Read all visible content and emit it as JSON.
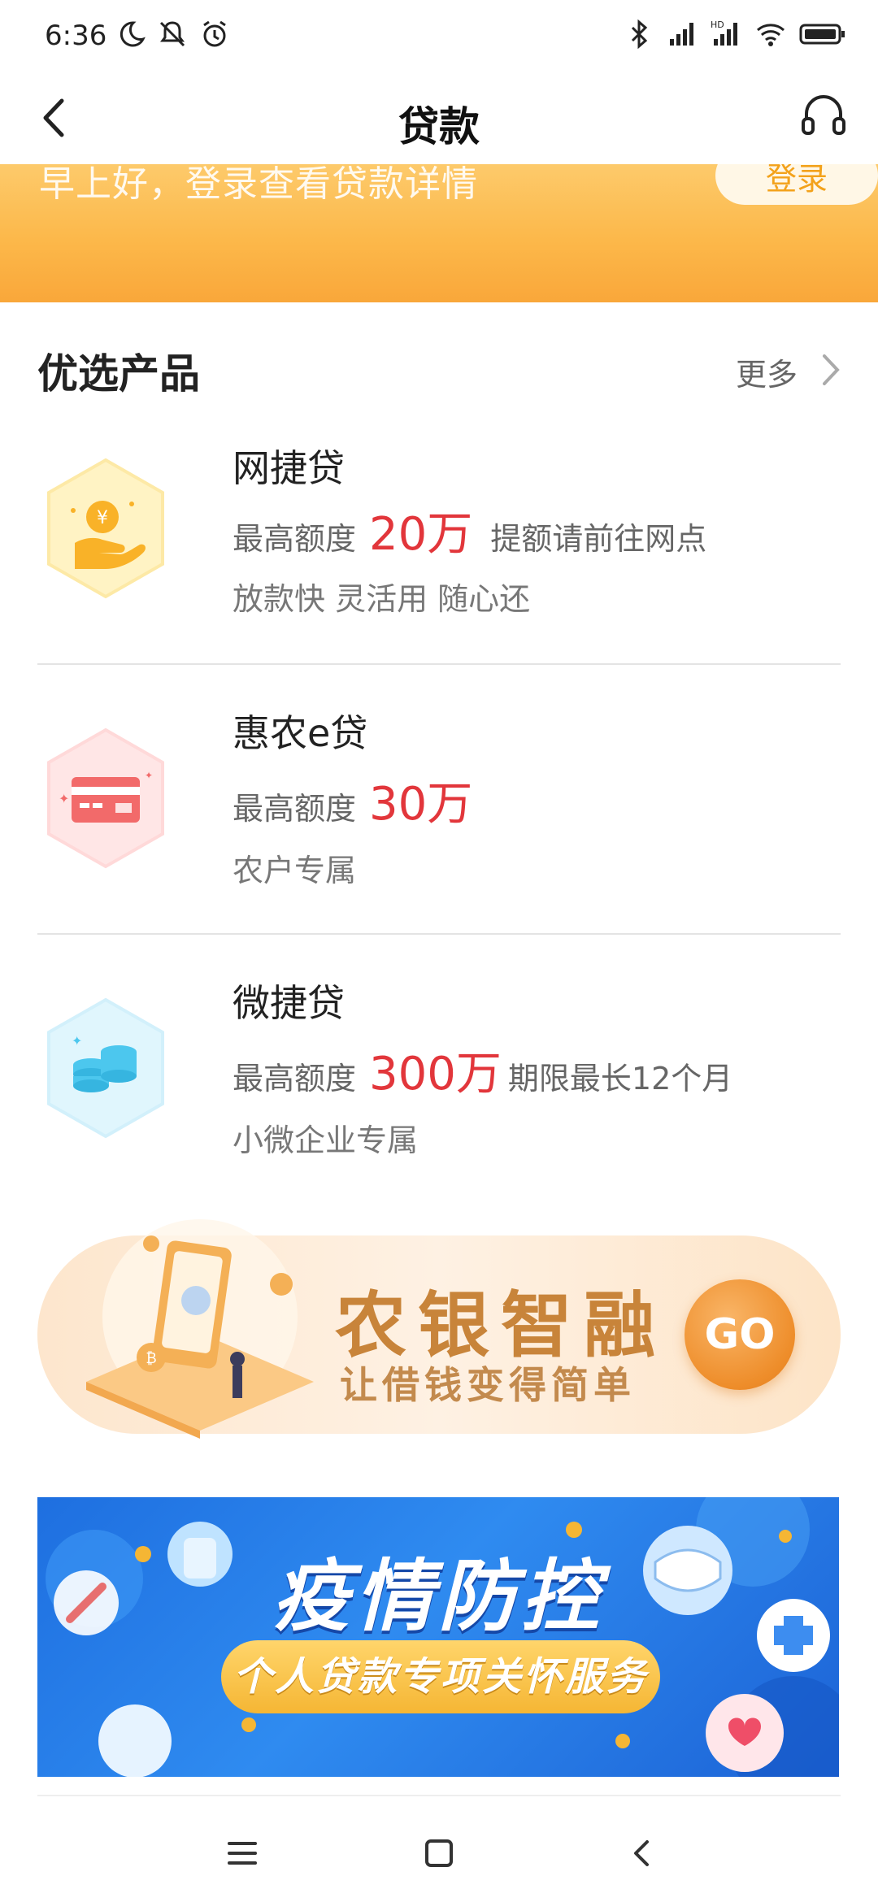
{
  "status_bar": {
    "time": "6:36",
    "icons_left": [
      "moon-icon",
      "silent-icon",
      "alarm-icon"
    ],
    "icons_right": [
      "bluetooth-icon",
      "signal-icon",
      "hd-signal-icon",
      "wifi-icon",
      "battery-icon"
    ]
  },
  "nav": {
    "title": "贷款",
    "back_icon": "back-icon",
    "service_icon": "headset-icon"
  },
  "banner": {
    "greeting": "早上好，登录查看贷款详情",
    "login_label": "登录"
  },
  "section": {
    "title": "优选产品",
    "more_label": "更多"
  },
  "products": [
    {
      "name": "网捷贷",
      "limit_label": "最高额度",
      "amount": "20万",
      "note": "提额请前往网点",
      "tag": "放款快 灵活用 随心还",
      "icon": "coin-hand-icon"
    },
    {
      "name": "惠农e贷",
      "limit_label": "最高额度",
      "amount": "30万",
      "note": "",
      "tag": "农户专属",
      "icon": "card-icon"
    },
    {
      "name": "微捷贷",
      "limit_label": "最高额度",
      "amount": "300万",
      "note": "期限最长12个月",
      "tag": "小微企业专属",
      "icon": "coins-stack-icon"
    }
  ],
  "promo": {
    "title": "农银智融",
    "subtitle": "让借钱变得简单",
    "go_label": "GO"
  },
  "covid_banner": {
    "title": "疫情防控",
    "subtitle": "个人贷款专项关怀服务"
  },
  "colors": {
    "accent_orange": "#fcb84a",
    "amount_red": "#e2363b",
    "banner_blue": "#1e6fe0"
  }
}
